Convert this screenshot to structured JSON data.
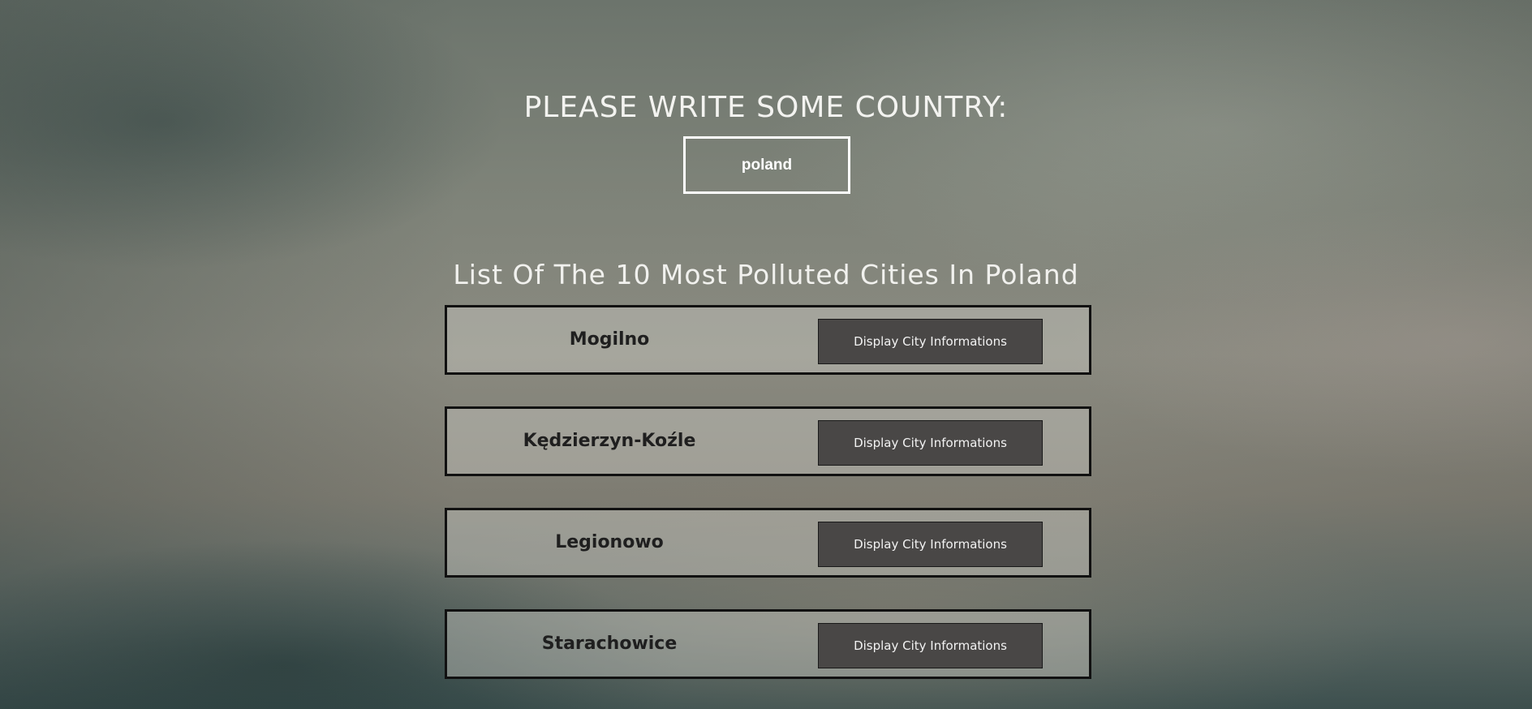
{
  "header": {
    "prompt": "PLEASE WRITE SOME COUNTRY:"
  },
  "search": {
    "value": "poland",
    "placeholder": ""
  },
  "list": {
    "title": "List Of The 10 Most Polluted Cities In Poland",
    "button_label": "Display City Informations",
    "cities": [
      {
        "name": "Mogilno"
      },
      {
        "name": "Kędzierzyn-Koźle"
      },
      {
        "name": "Legionowo"
      },
      {
        "name": "Starachowice"
      }
    ]
  },
  "colors": {
    "text_light": "#f3f3f0",
    "row_border": "#111111",
    "button_bg": "#494746",
    "city_text": "#1f1f1f"
  }
}
